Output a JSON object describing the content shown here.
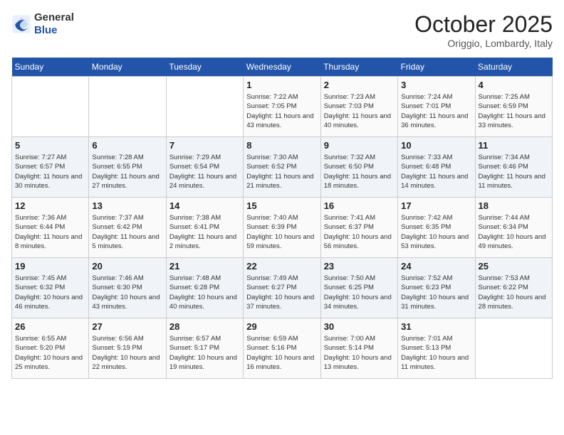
{
  "header": {
    "logo_general": "General",
    "logo_blue": "Blue",
    "month": "October 2025",
    "location": "Origgio, Lombardy, Italy"
  },
  "days_of_week": [
    "Sunday",
    "Monday",
    "Tuesday",
    "Wednesday",
    "Thursday",
    "Friday",
    "Saturday"
  ],
  "weeks": [
    [
      {
        "day": "",
        "info": ""
      },
      {
        "day": "",
        "info": ""
      },
      {
        "day": "",
        "info": ""
      },
      {
        "day": "1",
        "info": "Sunrise: 7:22 AM\nSunset: 7:05 PM\nDaylight: 11 hours and 43 minutes."
      },
      {
        "day": "2",
        "info": "Sunrise: 7:23 AM\nSunset: 7:03 PM\nDaylight: 11 hours and 40 minutes."
      },
      {
        "day": "3",
        "info": "Sunrise: 7:24 AM\nSunset: 7:01 PM\nDaylight: 11 hours and 36 minutes."
      },
      {
        "day": "4",
        "info": "Sunrise: 7:25 AM\nSunset: 6:59 PM\nDaylight: 11 hours and 33 minutes."
      }
    ],
    [
      {
        "day": "5",
        "info": "Sunrise: 7:27 AM\nSunset: 6:57 PM\nDaylight: 11 hours and 30 minutes."
      },
      {
        "day": "6",
        "info": "Sunrise: 7:28 AM\nSunset: 6:55 PM\nDaylight: 11 hours and 27 minutes."
      },
      {
        "day": "7",
        "info": "Sunrise: 7:29 AM\nSunset: 6:54 PM\nDaylight: 11 hours and 24 minutes."
      },
      {
        "day": "8",
        "info": "Sunrise: 7:30 AM\nSunset: 6:52 PM\nDaylight: 11 hours and 21 minutes."
      },
      {
        "day": "9",
        "info": "Sunrise: 7:32 AM\nSunset: 6:50 PM\nDaylight: 11 hours and 18 minutes."
      },
      {
        "day": "10",
        "info": "Sunrise: 7:33 AM\nSunset: 6:48 PM\nDaylight: 11 hours and 14 minutes."
      },
      {
        "day": "11",
        "info": "Sunrise: 7:34 AM\nSunset: 6:46 PM\nDaylight: 11 hours and 11 minutes."
      }
    ],
    [
      {
        "day": "12",
        "info": "Sunrise: 7:36 AM\nSunset: 6:44 PM\nDaylight: 11 hours and 8 minutes."
      },
      {
        "day": "13",
        "info": "Sunrise: 7:37 AM\nSunset: 6:42 PM\nDaylight: 11 hours and 5 minutes."
      },
      {
        "day": "14",
        "info": "Sunrise: 7:38 AM\nSunset: 6:41 PM\nDaylight: 11 hours and 2 minutes."
      },
      {
        "day": "15",
        "info": "Sunrise: 7:40 AM\nSunset: 6:39 PM\nDaylight: 10 hours and 59 minutes."
      },
      {
        "day": "16",
        "info": "Sunrise: 7:41 AM\nSunset: 6:37 PM\nDaylight: 10 hours and 56 minutes."
      },
      {
        "day": "17",
        "info": "Sunrise: 7:42 AM\nSunset: 6:35 PM\nDaylight: 10 hours and 53 minutes."
      },
      {
        "day": "18",
        "info": "Sunrise: 7:44 AM\nSunset: 6:34 PM\nDaylight: 10 hours and 49 minutes."
      }
    ],
    [
      {
        "day": "19",
        "info": "Sunrise: 7:45 AM\nSunset: 6:32 PM\nDaylight: 10 hours and 46 minutes."
      },
      {
        "day": "20",
        "info": "Sunrise: 7:46 AM\nSunset: 6:30 PM\nDaylight: 10 hours and 43 minutes."
      },
      {
        "day": "21",
        "info": "Sunrise: 7:48 AM\nSunset: 6:28 PM\nDaylight: 10 hours and 40 minutes."
      },
      {
        "day": "22",
        "info": "Sunrise: 7:49 AM\nSunset: 6:27 PM\nDaylight: 10 hours and 37 minutes."
      },
      {
        "day": "23",
        "info": "Sunrise: 7:50 AM\nSunset: 6:25 PM\nDaylight: 10 hours and 34 minutes."
      },
      {
        "day": "24",
        "info": "Sunrise: 7:52 AM\nSunset: 6:23 PM\nDaylight: 10 hours and 31 minutes."
      },
      {
        "day": "25",
        "info": "Sunrise: 7:53 AM\nSunset: 6:22 PM\nDaylight: 10 hours and 28 minutes."
      }
    ],
    [
      {
        "day": "26",
        "info": "Sunrise: 6:55 AM\nSunset: 5:20 PM\nDaylight: 10 hours and 25 minutes."
      },
      {
        "day": "27",
        "info": "Sunrise: 6:56 AM\nSunset: 5:19 PM\nDaylight: 10 hours and 22 minutes."
      },
      {
        "day": "28",
        "info": "Sunrise: 6:57 AM\nSunset: 5:17 PM\nDaylight: 10 hours and 19 minutes."
      },
      {
        "day": "29",
        "info": "Sunrise: 6:59 AM\nSunset: 5:16 PM\nDaylight: 10 hours and 16 minutes."
      },
      {
        "day": "30",
        "info": "Sunrise: 7:00 AM\nSunset: 5:14 PM\nDaylight: 10 hours and 13 minutes."
      },
      {
        "day": "31",
        "info": "Sunrise: 7:01 AM\nSunset: 5:13 PM\nDaylight: 10 hours and 11 minutes."
      },
      {
        "day": "",
        "info": ""
      }
    ]
  ]
}
